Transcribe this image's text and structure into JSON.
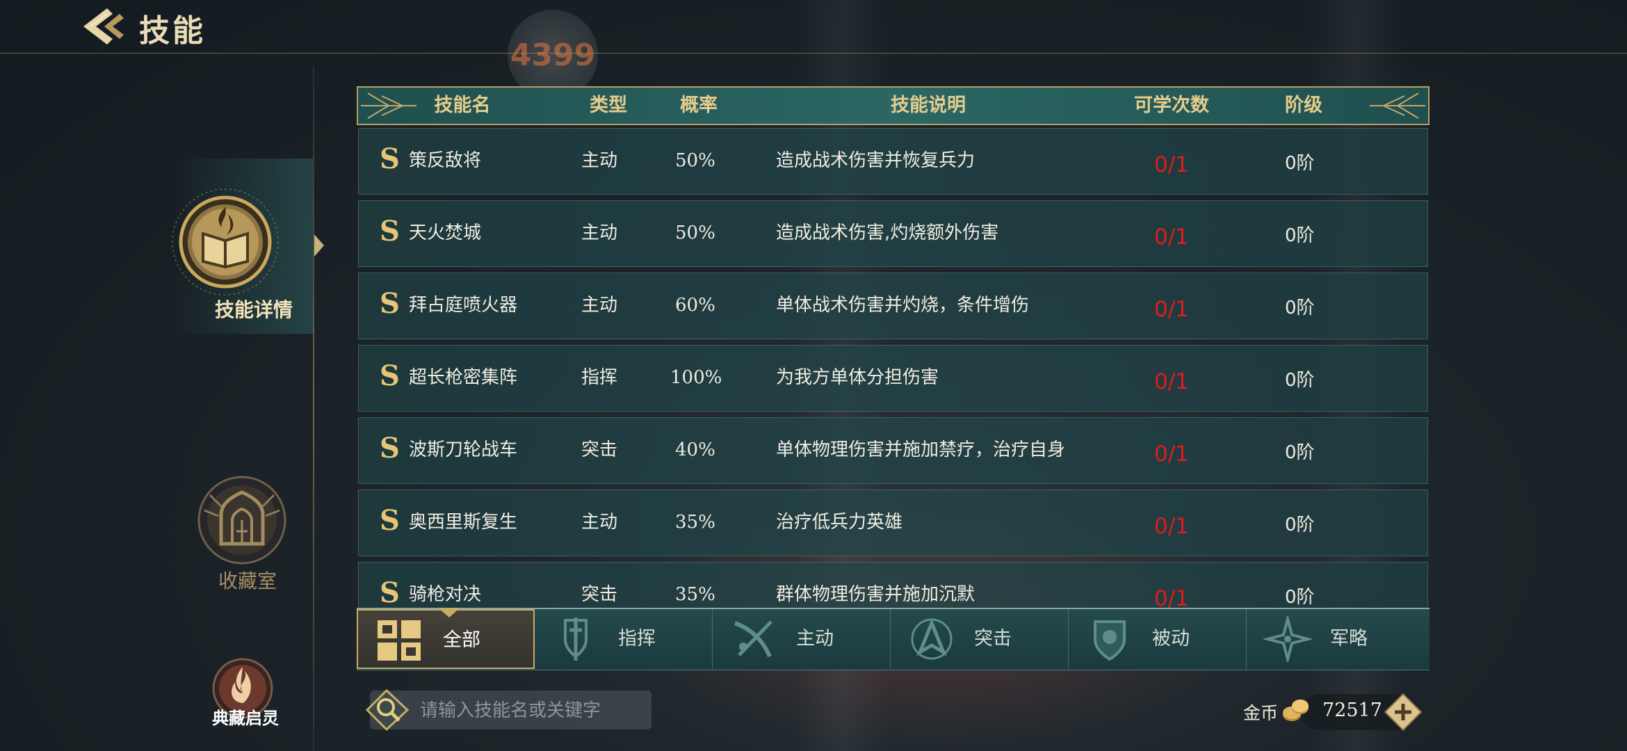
{
  "header": {
    "title": "技能",
    "watermark": "4399"
  },
  "nav": [
    {
      "id": "skill-detail",
      "label": "技能详情",
      "active": true
    },
    {
      "id": "collection",
      "label": "收藏室",
      "active": false
    },
    {
      "id": "classic",
      "label": "典藏启灵",
      "active": false
    }
  ],
  "table": {
    "headers": [
      "技能名",
      "类型",
      "概率",
      "技能说明",
      "可学次数",
      "阶级"
    ],
    "rows": [
      {
        "grade": "S",
        "name": "策反敌将",
        "type": "主动",
        "rate": "50%",
        "desc": "造成战术伤害并恢复兵力",
        "count": "0/1",
        "tier": "0阶"
      },
      {
        "grade": "S",
        "name": "天火焚城",
        "type": "主动",
        "rate": "50%",
        "desc": "造成战术伤害,灼烧额外伤害",
        "count": "0/1",
        "tier": "0阶"
      },
      {
        "grade": "S",
        "name": "拜占庭喷火器",
        "type": "主动",
        "rate": "60%",
        "desc": "单体战术伤害并灼烧，条件增伤",
        "count": "0/1",
        "tier": "0阶"
      },
      {
        "grade": "S",
        "name": "超长枪密集阵",
        "type": "指挥",
        "rate": "100%",
        "desc": "为我方单体分担伤害",
        "count": "0/1",
        "tier": "0阶"
      },
      {
        "grade": "S",
        "name": "波斯刀轮战车",
        "type": "突击",
        "rate": "40%",
        "desc": "单体物理伤害并施加禁疗，治疗自身",
        "count": "0/1",
        "tier": "0阶"
      },
      {
        "grade": "S",
        "name": "奥西里斯复生",
        "type": "主动",
        "rate": "35%",
        "desc": "治疗低兵力英雄",
        "count": "0/1",
        "tier": "0阶"
      },
      {
        "grade": "S",
        "name": "骑枪对决",
        "type": "突击",
        "rate": "35%",
        "desc": "群体物理伤害并施加沉默",
        "count": "0/1",
        "tier": "0阶"
      }
    ]
  },
  "filters": [
    {
      "label": "全部",
      "icon": "grid-icon",
      "active": true
    },
    {
      "label": "指挥",
      "icon": "sword-shield-icon",
      "active": false
    },
    {
      "label": "主动",
      "icon": "crossed-blades-icon",
      "active": false
    },
    {
      "label": "突击",
      "icon": "arrowhead-icon",
      "active": false
    },
    {
      "label": "被动",
      "icon": "shield-icon",
      "active": false
    },
    {
      "label": "军略",
      "icon": "compass-star-icon",
      "active": false
    }
  ],
  "search": {
    "placeholder": "请输入技能名或关键字"
  },
  "currency": {
    "label": "金币",
    "amount": "72517"
  },
  "colors": {
    "gold": "#c8ab66",
    "count_red": "#e01b1b",
    "header_teal": "#2b6765"
  }
}
